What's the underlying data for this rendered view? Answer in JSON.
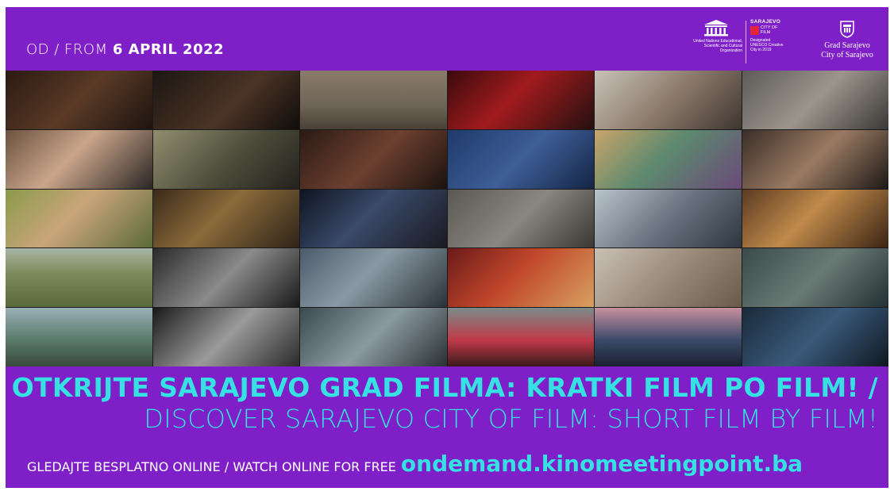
{
  "date": {
    "prefix": "OD / FROM",
    "value": "6 APRIL 2022"
  },
  "logos": {
    "unesco_text": "United Nations Educational, Scientific and Cultural Organization",
    "city_name": "SARAJEVO",
    "city_of_film": "CITY OF FILM",
    "designation": "Designated UNESCO Creative City in 2019",
    "grad_line1": "Grad Sarajevo",
    "grad_line2": "City of Sarajevo"
  },
  "headline": {
    "bosnian": "OTKRIJTE SARAJEVO GRAD FILMA: KRATKI FILM PO FILM! /",
    "english": "DISCOVER SARAJEVO CITY OF FILM: SHORT FILM BY FILM!"
  },
  "watch": {
    "label": "GLEDAJTE BESPLATNO ONLINE / WATCH ONLINE FOR FREE",
    "url": "ondemand.kinomeetingpoint.ba"
  },
  "colors": {
    "background": "#7e1fc7",
    "accent": "#35e1e2",
    "text": "#ffffff"
  },
  "stills": [
    {
      "bg": "linear-gradient(135deg,#2a1a12,#5a3a26 50%,#1d1410)"
    },
    {
      "bg": "linear-gradient(135deg,#1c1612,#4b3426 55%,#0f0c0a)"
    },
    {
      "bg": "linear-gradient(180deg,#8a7c6a,#6e6456 60%,#4a3f36)"
    },
    {
      "bg": "linear-gradient(135deg,#3a0a0c,#a11b1d 45%,#241010)"
    },
    {
      "bg": "linear-gradient(135deg,#c8c2b8,#8c7b6c 50%,#3f3530)"
    },
    {
      "bg": "linear-gradient(135deg,#5c5a58,#9c958c 50%,#3a3836)"
    },
    {
      "bg": "linear-gradient(135deg,#6b5240,#caa58a 45%,#2a2624)"
    },
    {
      "bg": "linear-gradient(135deg,#8f8e6e,#4b4b3a 55%,#22221c)"
    },
    {
      "bg": "linear-gradient(135deg,#2a1a14,#6d4030 50%,#1b120f)"
    },
    {
      "bg": "linear-gradient(135deg,#1f3a6a,#3e5e98 50%,#142544)"
    },
    {
      "bg": "linear-gradient(135deg,#c9a46c,#5e8a6e 45%,#6a4a7a)"
    },
    {
      "bg": "linear-gradient(135deg,#3a2e28,#9a7a62 50%,#1c1816)"
    },
    {
      "bg": "linear-gradient(135deg,#8a9a4a,#c9a57a 45%,#5a6a3a)"
    },
    {
      "bg": "linear-gradient(135deg,#3a2a1a,#8a6a3a 45%,#2e2418)"
    },
    {
      "bg": "linear-gradient(135deg,#0f1420,#3a4a6a 45%,#1a1a22)"
    },
    {
      "bg": "linear-gradient(135deg,#5a5852,#8a8680 50%,#3a3834)"
    },
    {
      "bg": "linear-gradient(135deg,#b8c4cc,#6a7480 50%,#2e3640)"
    },
    {
      "bg": "linear-gradient(135deg,#5a3a22,#c08a4a 45%,#3a2414)"
    },
    {
      "bg": "linear-gradient(180deg,#a8b4a4,#7a8a5a 45%,#5a6a3a)"
    },
    {
      "bg": "linear-gradient(135deg,#2a2a2a,#8a8a8a 50%,#1a1a1a)"
    },
    {
      "bg": "linear-gradient(135deg,#4a5a6a,#8a9aa4 45%,#2a3238)"
    },
    {
      "bg": "linear-gradient(135deg,#6a1a1a,#c0462a 45%,#d8a060)"
    },
    {
      "bg": "linear-gradient(135deg,#c8c0b4,#9a8a7a 50%,#6a5a4a)"
    },
    {
      "bg": "linear-gradient(135deg,#3a4a4a,#6a7a74 50%,#243032)"
    },
    {
      "bg": "linear-gradient(180deg,#9ab0b8,#5a7a6a 55%,#3a4a3a)"
    },
    {
      "bg": "linear-gradient(135deg,#1a1a1a,#9a9a9a 50%,#2a2a2a)"
    },
    {
      "bg": "linear-gradient(135deg,#3a4a50,#8a9aa0 50%,#2a3034)"
    },
    {
      "bg": "linear-gradient(180deg,#7a8a8a,#c03a4a 55%,#3a1a1a)"
    },
    {
      "bg": "linear-gradient(180deg,#c890a0,#3a4a6a 55%,#1a2030)"
    },
    {
      "bg": "linear-gradient(135deg,#1a2a3a,#3a5a7a 50%,#101822)"
    }
  ]
}
